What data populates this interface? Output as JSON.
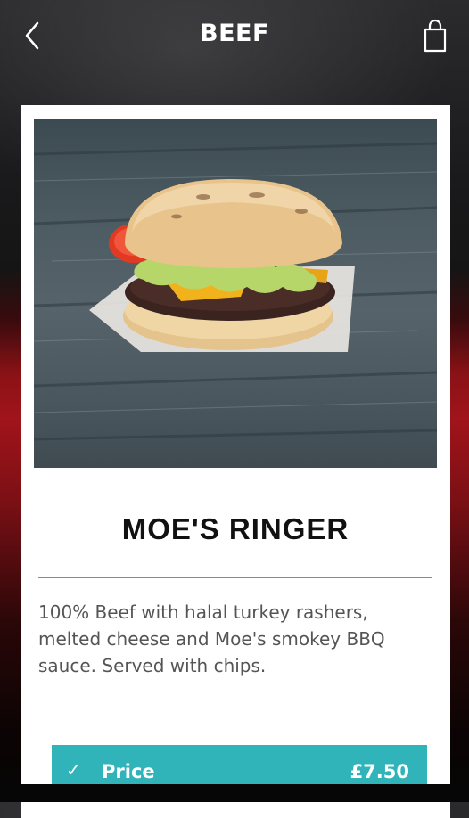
{
  "header": {
    "title": "BEEF",
    "back_icon": "chevron-left-icon",
    "cart_icon": "shopping-bag-icon"
  },
  "product": {
    "name": "MOE'S RINGER",
    "description": "100% Beef with halal turkey rashers, melted cheese and Moe's smokey BBQ sauce. Served with chips.",
    "image": "burger-photo"
  },
  "price": {
    "label": "Price",
    "value": "£7.50",
    "check_icon": "checkmark-icon",
    "selected": true
  },
  "colors": {
    "accent": "#31b4b9",
    "background_red": "#a0141a",
    "card": "#ffffff"
  }
}
